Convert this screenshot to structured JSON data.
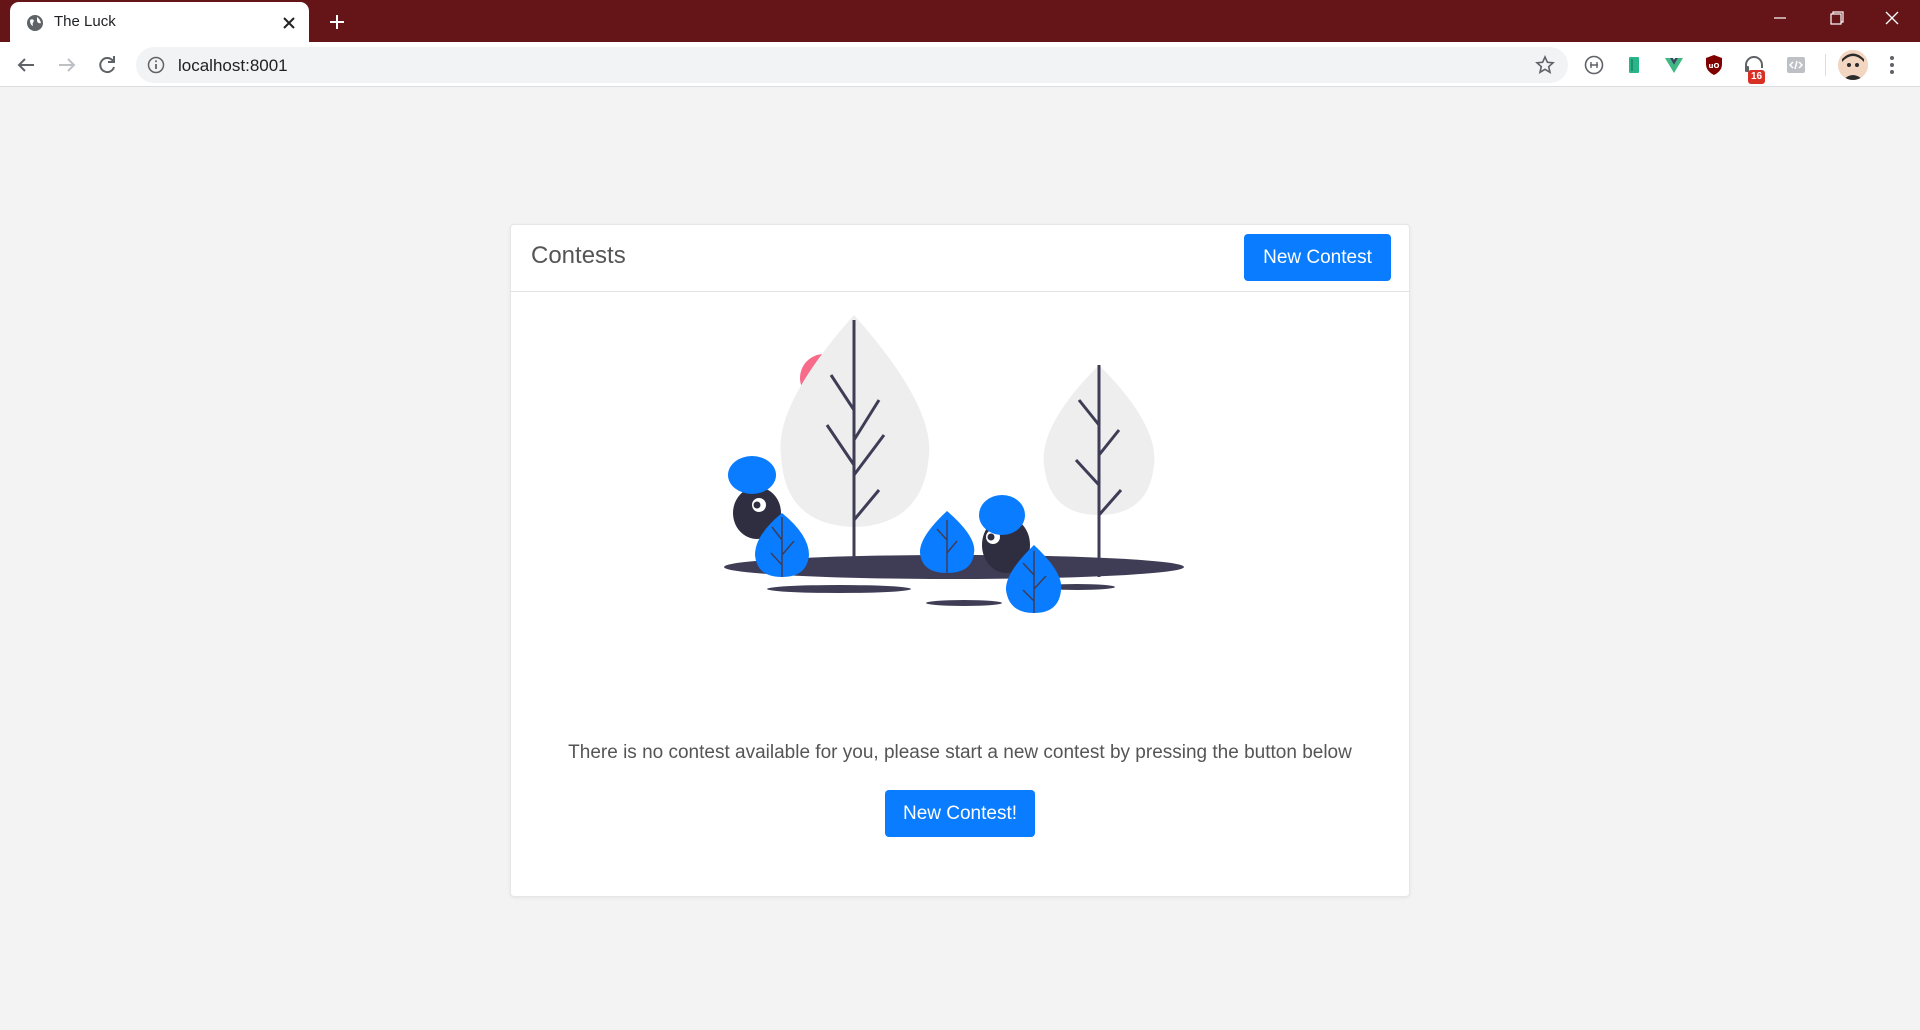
{
  "browser": {
    "tab_title": "The Luck",
    "url": "localhost:8001",
    "extension_badge": "16",
    "colors": {
      "titlebar": "#651417",
      "accent": "#0a7cff"
    }
  },
  "page": {
    "header_title": "Contests",
    "header_button": "New Contest",
    "empty_message": "There is no contest available for you, please start a new contest by pressing the button below",
    "empty_button": "New Contest!"
  }
}
